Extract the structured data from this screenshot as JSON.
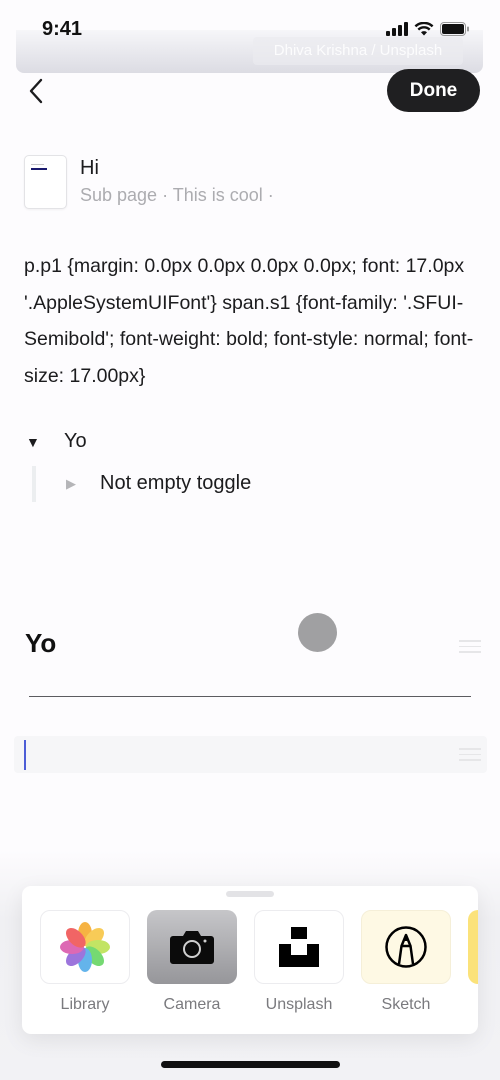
{
  "status_bar": {
    "time": "9:41",
    "icons": [
      "signal-icon",
      "wifi-icon",
      "battery-icon"
    ]
  },
  "cover": {
    "credit": "Dhiva Krishna / Unsplash"
  },
  "nav": {
    "back_icon": "chevron-left-icon",
    "done_label": "Done"
  },
  "subpage": {
    "icon": "page-icon",
    "title": "Hi",
    "subtitle": "Sub page · This is cool ·"
  },
  "body_text": "p.p1 {margin: 0.0px 0.0px 0.0px 0.0px; font: 17.0px '.AppleSystemUIFont'} span.s1 {font-family: '.SFUI-Semibold'; font-weight: bold; font-style: normal; font-size: 17.00px}",
  "toggle": {
    "label": "Yo",
    "expanded": true,
    "children": [
      {
        "label": "Not empty toggle",
        "expanded": false
      }
    ]
  },
  "heading": {
    "text": "Yo"
  },
  "empty_block": {
    "value": ""
  },
  "media_sheet": {
    "items": [
      {
        "label": "Library",
        "icon": "photos-icon"
      },
      {
        "label": "Camera",
        "icon": "camera-icon"
      },
      {
        "label": "Unsplash",
        "icon": "unsplash-icon"
      },
      {
        "label": "Sketch",
        "icon": "sketch-pen-icon"
      }
    ]
  }
}
